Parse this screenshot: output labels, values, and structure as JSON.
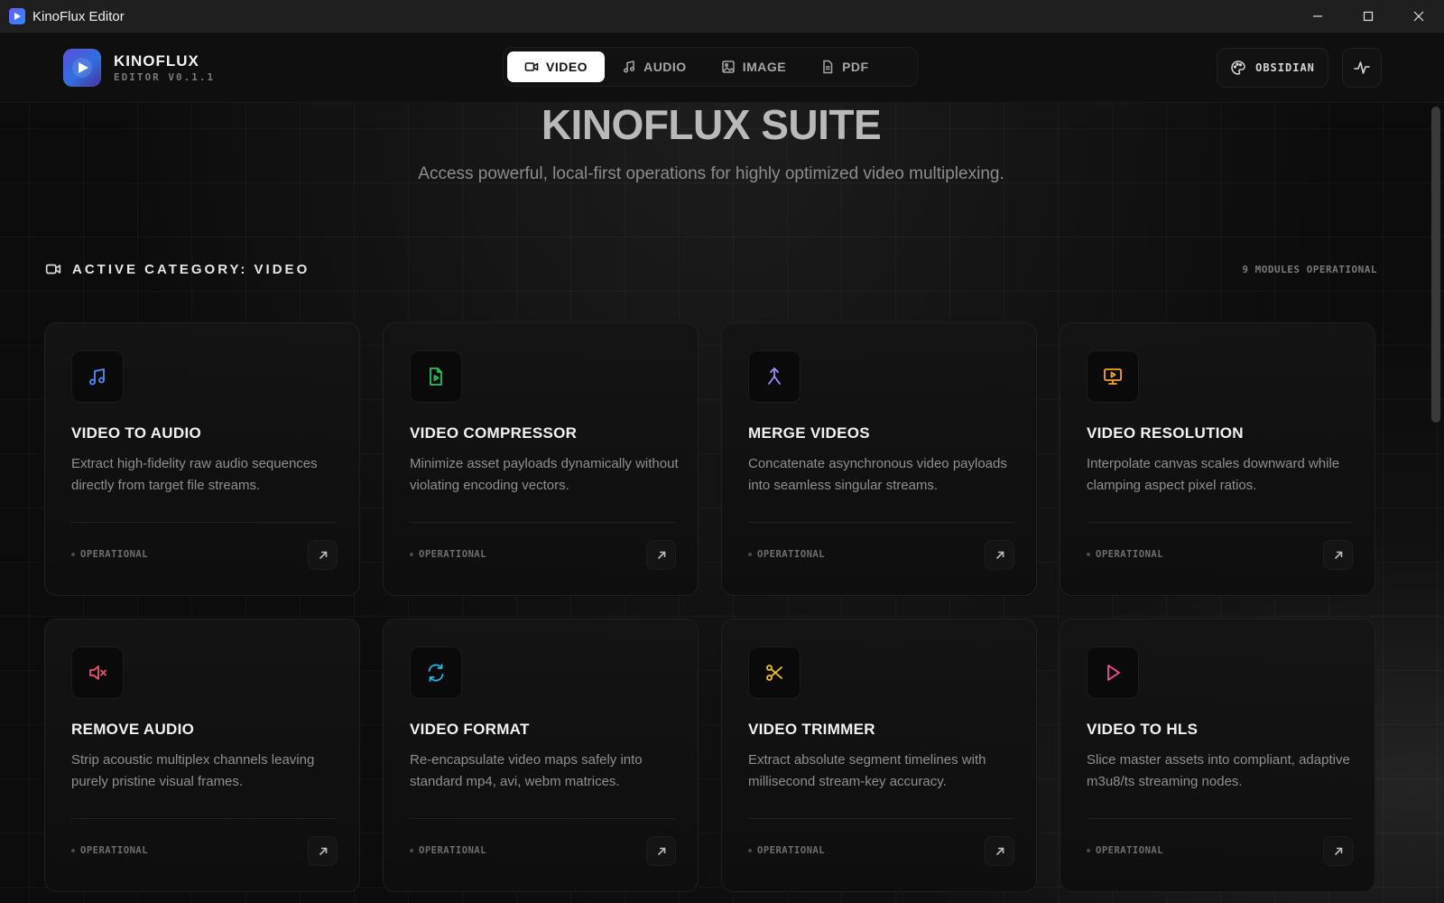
{
  "window": {
    "title": "KinoFlux Editor",
    "controls": [
      "minimize-icon",
      "maximize-icon",
      "close-icon"
    ]
  },
  "header": {
    "brand_name": "KINOFLUX",
    "brand_version": "EDITOR V0.1.1",
    "tabs": [
      {
        "label": "VIDEO",
        "icon": "video-camera-icon",
        "active": true
      },
      {
        "label": "AUDIO",
        "icon": "music-note-icon",
        "active": false
      },
      {
        "label": "IMAGE",
        "icon": "image-icon",
        "active": false
      },
      {
        "label": "PDF",
        "icon": "document-icon",
        "active": false
      }
    ],
    "theme_label": "OBSIDIAN",
    "theme_icon": "palette-icon",
    "activity_icon": "pulse-icon"
  },
  "hero": {
    "title": "KINOFLUX SUITE",
    "subtitle": "Access powerful, local-first operations for highly optimized video multiplexing."
  },
  "section": {
    "title": "ACTIVE CATEGORY: VIDEO",
    "count": "9 MODULES OPERATIONAL"
  },
  "cards": [
    {
      "title": "VIDEO TO AUDIO",
      "desc": "Extract high-fidelity raw audio sequences directly from target file streams.",
      "status": "OPERATIONAL",
      "icon": "music-note-icon",
      "color": "#4f8cff"
    },
    {
      "title": "VIDEO COMPRESSOR",
      "desc": "Minimize asset payloads dynamically without violating encoding vectors.",
      "status": "OPERATIONAL",
      "icon": "file-video-icon",
      "color": "#22c55e"
    },
    {
      "title": "MERGE VIDEOS",
      "desc": "Concatenate asynchronous video payloads into seamless singular streams.",
      "status": "OPERATIONAL",
      "icon": "merge-icon",
      "color": "#a78bfa"
    },
    {
      "title": "VIDEO RESOLUTION",
      "desc": "Interpolate canvas scales downward while clamping aspect pixel ratios.",
      "status": "OPERATIONAL",
      "icon": "monitor-play-icon",
      "color": "#f5a524"
    },
    {
      "title": "REMOVE AUDIO",
      "desc": "Strip acoustic multiplex channels leaving purely pristine visual frames.",
      "status": "OPERATIONAL",
      "icon": "volume-mute-icon",
      "color": "#f0506e"
    },
    {
      "title": "VIDEO FORMAT",
      "desc": "Re-encapsulate video maps safely into standard mp4, avi, webm matrices.",
      "status": "OPERATIONAL",
      "icon": "refresh-icon",
      "color": "#22b8e6"
    },
    {
      "title": "VIDEO TRIMMER",
      "desc": "Extract absolute segment timelines with millisecond stream-key accuracy.",
      "status": "OPERATIONAL",
      "icon": "scissors-icon",
      "color": "#f5c518"
    },
    {
      "title": "VIDEO TO HLS",
      "desc": "Slice master assets into compliant, adaptive m3u8/ts streaming nodes.",
      "status": "OPERATIONAL",
      "icon": "play-icon",
      "color": "#f0509a"
    }
  ]
}
